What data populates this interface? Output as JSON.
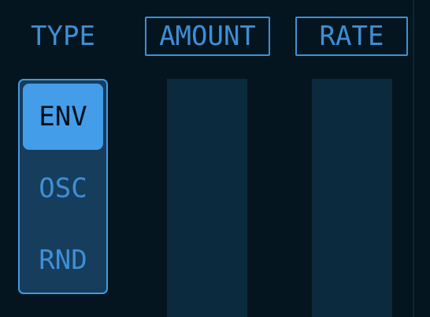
{
  "header": {
    "type_label": "TYPE",
    "amount_label": "AMOUNT",
    "rate_label": "RATE"
  },
  "type_selector": {
    "options": [
      {
        "label": "ENV",
        "selected": true
      },
      {
        "label": "OSC",
        "selected": false
      },
      {
        "label": "RND",
        "selected": false
      }
    ]
  },
  "colors": {
    "background": "#04151f",
    "accent": "#3e8fd6",
    "selected_fill": "#449de8",
    "selector_bg": "#163d5c",
    "track": "#0b2a3e"
  }
}
